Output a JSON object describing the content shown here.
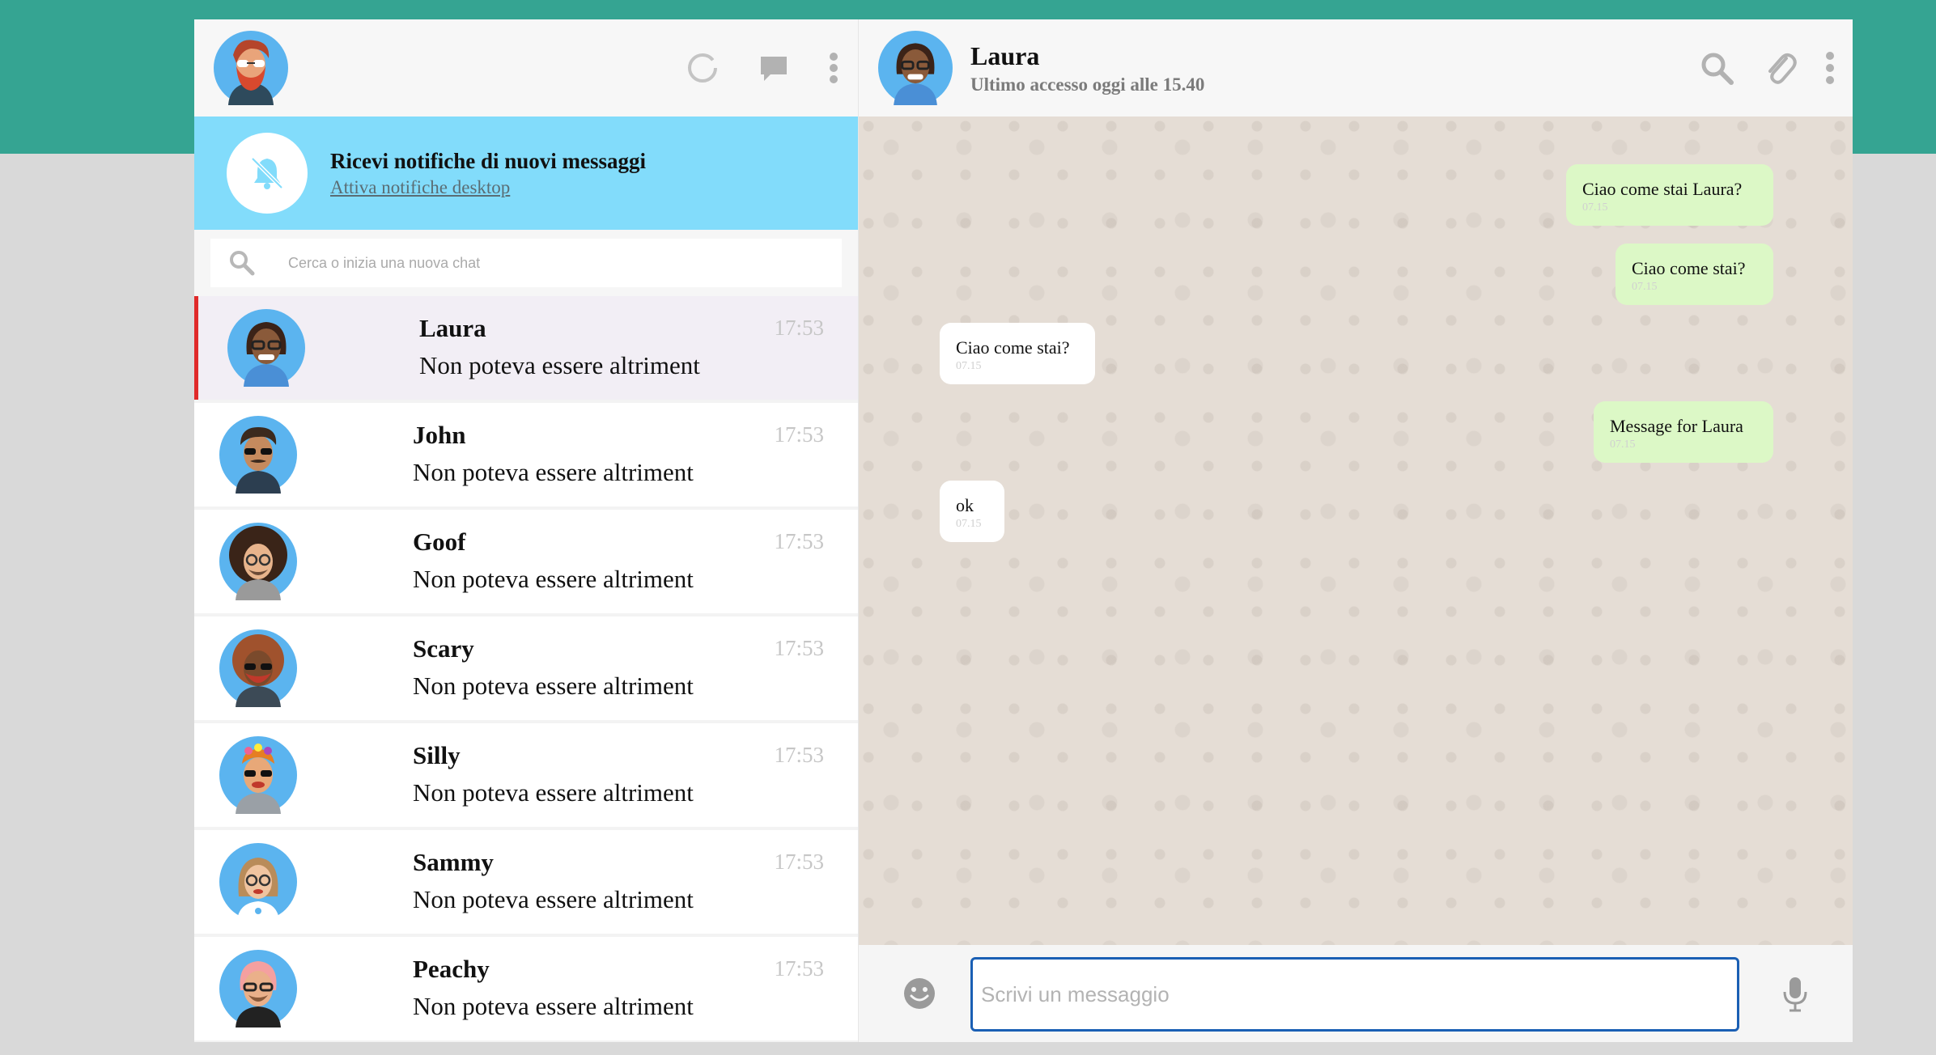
{
  "sidebar": {
    "notification": {
      "title": "Ricevi notifiche di nuovi messaggi",
      "link": "Attiva notifiche desktop"
    },
    "search_placeholder": "Cerca o inizia una nuova chat",
    "chats": [
      {
        "name": "Laura",
        "last": "Non poteva essere altriment",
        "time": "17:53",
        "active": true
      },
      {
        "name": "John",
        "last": "Non poteva essere altriment",
        "time": "17:53"
      },
      {
        "name": "Goof",
        "last": "Non poteva essere altriment",
        "time": "17:53"
      },
      {
        "name": "Scary",
        "last": "Non poteva essere altriment",
        "time": "17:53"
      },
      {
        "name": "Silly",
        "last": "Non poteva essere altriment",
        "time": "17:53"
      },
      {
        "name": "Sammy",
        "last": "Non poteva essere altriment",
        "time": "17:53"
      },
      {
        "name": "Peachy",
        "last": "Non poteva essere altriment",
        "time": "17:53"
      }
    ]
  },
  "conversation": {
    "name": "Laura",
    "status": "Ultimo accesso oggi alle 15.40",
    "messages": [
      {
        "text": "Ciao come stai Laura?",
        "time": "07.15",
        "direction": "out"
      },
      {
        "text": "Ciao come stai?",
        "time": "07.15",
        "direction": "out"
      },
      {
        "text": "Ciao come stai?",
        "time": "07.15",
        "direction": "in"
      },
      {
        "text": "Message for Laura",
        "time": "07.15",
        "direction": "out"
      },
      {
        "text": "ok",
        "time": "07.15",
        "direction": "in"
      }
    ],
    "compose_placeholder": "Scrivi un messaggio"
  },
  "colors": {
    "top_band": "#35a492",
    "notify_bg": "#82dcfb",
    "outgoing_bubble": "#dcf8c6",
    "active_marker": "#e02a2a",
    "avatar_bg": "#5bb4ef"
  },
  "icons": [
    "status-icon",
    "new-chat-icon",
    "menu-icon",
    "bell-off-icon",
    "search-icon",
    "attach-icon",
    "emoji-icon",
    "microphone-icon"
  ]
}
